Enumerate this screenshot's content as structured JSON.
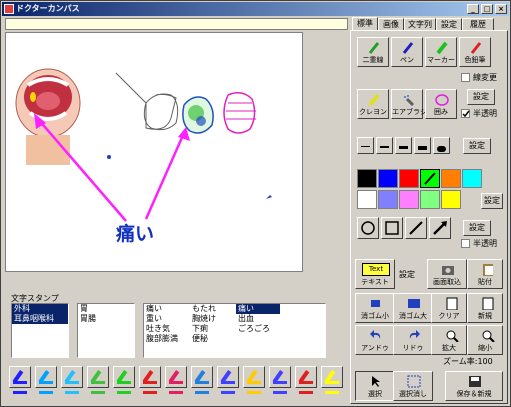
{
  "window": {
    "title": "ドクターカンパス"
  },
  "canvas": {
    "annotation_text": "痛い"
  },
  "stamp": {
    "label": "文字スタンプ",
    "list1": [
      "外科",
      "耳鼻咽喉科"
    ],
    "list2": [
      "胃",
      "胃腸"
    ],
    "list3a": [
      "痛い",
      "重い",
      "吐き気",
      "腹部膨満"
    ],
    "list3b": [
      "もたれ",
      "胸焼け",
      "下痢",
      "便秘"
    ],
    "list3c": [
      "痛い",
      "出血",
      "ごろごろ"
    ]
  },
  "tabs": [
    "標準",
    "画像",
    "文字列",
    "設定",
    "履歴"
  ],
  "tools": [
    {
      "label": "二重線",
      "color": "#20a020"
    },
    {
      "label": "ペン",
      "color": "#2020c0"
    },
    {
      "label": "マーカー",
      "color": "#20c020"
    },
    {
      "label": "色鉛筆",
      "color": "#e02020"
    },
    {
      "label": "クレヨン",
      "color": "#e0e020"
    },
    {
      "label": "エアブラシ",
      "color": "#2080e0"
    },
    {
      "label": "囲み",
      "color": "#e020e0"
    }
  ],
  "options": {
    "line_change": "線変更",
    "semi_transparent": "半透明",
    "settings": "設定"
  },
  "palette": [
    "#000000",
    "#0000ff",
    "#ff0000",
    "#00ff00",
    "#ff8000",
    "#00ffff",
    "#ffffff",
    "#8080ff",
    "#ff80ff",
    "#80ff80",
    "#ffff00"
  ],
  "actions": {
    "text": "テキスト",
    "settings": "設定",
    "capture": "画面取込",
    "paste": "貼付",
    "erase_small": "消ゴム小",
    "erase_large": "消ゴム大",
    "clear": "クリア",
    "new": "新規",
    "undo": "アンドゥ",
    "redo": "リドゥ",
    "zoom_in": "拡大",
    "zoom_out": "縮小",
    "zoom_label": "ズーム率:100",
    "select": "選択",
    "deselect": "選択消し",
    "save_new": "保存＆新規",
    "text_icon": "Text"
  },
  "bottom_pens": [
    {
      "color": "#2020ff"
    },
    {
      "color": "#00a0ff"
    },
    {
      "color": "#20c0ff"
    },
    {
      "color": "#40c040"
    },
    {
      "color": "#20d020"
    },
    {
      "color": "#e02020"
    },
    {
      "color": "#e02060"
    },
    {
      "color": "#2080e0"
    },
    {
      "color": "#4040ff"
    },
    {
      "color": "#ffcc00"
    },
    {
      "color": "#4040ff"
    },
    {
      "color": "#e02020"
    },
    {
      "color": "#ffff00"
    }
  ]
}
